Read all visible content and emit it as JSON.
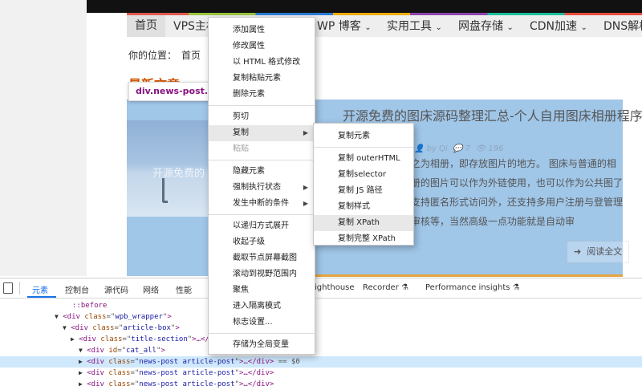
{
  "nav": {
    "items": [
      "首页",
      "VPS主机",
      "WP 博客",
      "实用工具",
      "网盘存储",
      "CDN加速",
      "DNS解析"
    ]
  },
  "breadcrumb": {
    "label": "你的位置：",
    "home": "首页"
  },
  "section": {
    "title": "最新文章"
  },
  "tooltip": {
    "text": "div.news-post.article-post"
  },
  "post": {
    "title": "开源免费的图床源码整理汇总-个人自用图床相册程序",
    "image_caption": "开源免费的",
    "meta": {
      "author": "by Qi",
      "comments": "7",
      "views": "196"
    },
    "excerpt": "之为相册，即存放图片的地方。 图床与普通的相册的图片可以作为外链使用，也可以作为公共图了支持匿名形式访问外，还支持多用户注册与登管理审核等，当然高级一点功能就是自动审",
    "read_more": "阅读全文"
  },
  "devtools": {
    "tabs": [
      "元素",
      "控制台",
      "源代码",
      "网络",
      "性能"
    ],
    "tab_lighthouse": "ighthouse",
    "tab_recorder": "Recorder",
    "tab_performance_insights": "Performance insights",
    "lines": [
      {
        "indent": 0,
        "text": "::before"
      },
      {
        "indent": 1,
        "tag": "div",
        "cls": "wpb_wrapper",
        "tail": ">"
      },
      {
        "indent": 2,
        "tag": "div",
        "cls": "article-box",
        "tail": ">"
      },
      {
        "indent": 3,
        "tag": "div",
        "cls": "title-section",
        "tail": ">…</"
      },
      {
        "indent": 3,
        "tag": "div",
        "idval": "cat_all",
        "tail": ">"
      },
      {
        "indent": 4,
        "tag": "div",
        "cls": "news-post article-post",
        "tail": ">…</div>",
        "marker": "== $0"
      },
      {
        "indent": 4,
        "tag": "div",
        "cls": "news-post article-post",
        "tail": ">…</div>"
      },
      {
        "indent": 4,
        "tag": "div",
        "cls": "news-post article-post",
        "tail": ">…</div>"
      }
    ]
  },
  "context_menu": {
    "groups": [
      [
        "添加属性",
        "修改属性",
        "以 HTML 格式修改",
        "复制粘贴元素",
        "删除元素"
      ],
      [
        "剪切",
        "复制",
        "粘贴"
      ],
      [
        "隐藏元素",
        "强制执行状态",
        "发生中断的条件"
      ],
      [
        "以递归方式展开",
        "收起子级",
        "截取节点屏幕截图",
        "滚动到视野范围内",
        "聚焦",
        "进入隔离模式",
        "标志设置..."
      ],
      [
        "存储为全局变量"
      ]
    ],
    "submenu_parents": [
      "复制",
      "强制执行状态",
      "发生中断的条件"
    ],
    "disabled": [
      "粘贴"
    ],
    "hovered": "复制"
  },
  "copy_submenu": {
    "groups": [
      [
        "复制元素"
      ],
      [
        "复制 outerHTML",
        "复制selector",
        "复制 JS 路径",
        "复制样式",
        "复制 XPath",
        "复制完整 XPath"
      ]
    ],
    "hovered": "复制 XPath"
  }
}
